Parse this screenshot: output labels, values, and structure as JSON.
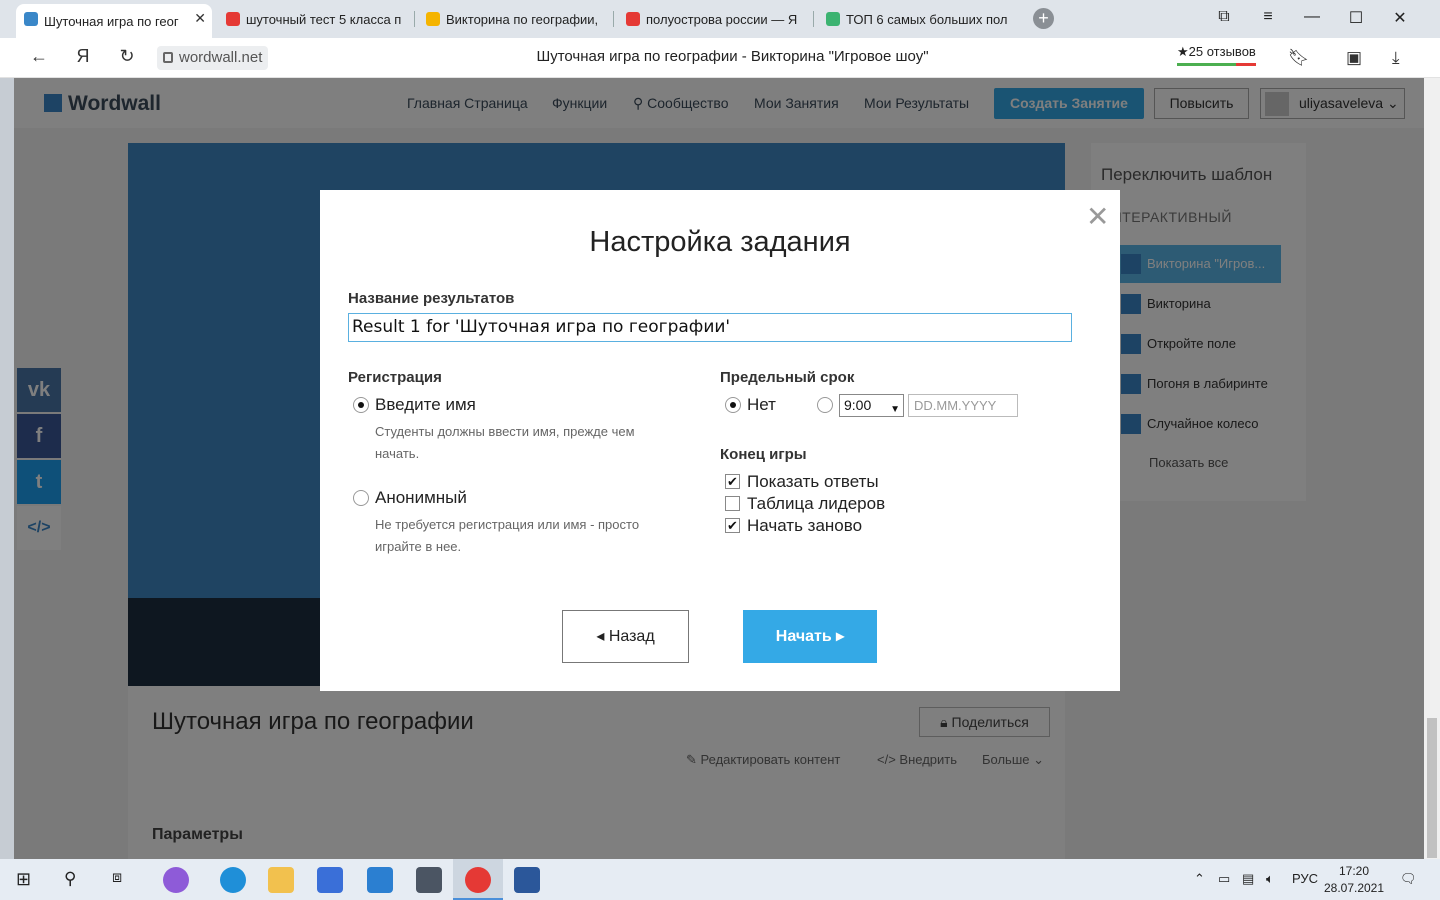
{
  "browser": {
    "tabs": [
      {
        "label": "Шуточная игра по геог",
        "active": true,
        "color": "#3a87c8"
      },
      {
        "label": "шуточный тест 5 класса п",
        "active": false,
        "color": "#e53935"
      },
      {
        "label": "Викторина по географии,",
        "active": false,
        "color": "#f5b400"
      },
      {
        "label": "полуострова россии — Я",
        "active": false,
        "color": "#e53935"
      },
      {
        "label": "ТОП 6 самых больших пол",
        "active": false,
        "color": "#3cb371"
      }
    ],
    "url": "wordwall.net",
    "page_title": "Шуточная игра по географии - Викторина \"Игровое шоу\"",
    "reviews": "★25 отзывов"
  },
  "site": {
    "logo": "Wordwall",
    "nav": [
      "Главная Страница",
      "Функции",
      "Сообщество",
      "Мои Занятия",
      "Мои Результаты"
    ],
    "create_button": "Создать Занятие",
    "upgrade_button": "Повысить",
    "username": "uliyasaveleva",
    "activity_title": "Шуточная игра по географии",
    "share_button": "Поделиться",
    "edit_link": "Редактировать контент",
    "embed_link": "Внедрить",
    "more_link": "Больше",
    "params_heading": "Параметры",
    "side": {
      "heading": "Переключить шаблон",
      "subheading": "ИНТЕРАКТИВНЫЙ",
      "items": [
        "Викторина \"Игров...",
        "Викторина",
        "Откройте поле",
        "Погоня в лабиринте",
        "Случайное колесо"
      ],
      "show_all": "Показать все"
    }
  },
  "modal": {
    "title": "Настройка задания",
    "results_label": "Название результатов",
    "results_value": "Result 1 for 'Шуточная игра по географии'",
    "registration_label": "Регистрация",
    "reg_option1": "Введите имя",
    "reg_option1_hint": "Студенты должны ввести имя, прежде чем начать.",
    "reg_option2": "Анонимный",
    "reg_option2_hint": "Не требуется регистрация или имя - просто играйте в нее.",
    "deadline_label": "Предельный срок",
    "deadline_none": "Нет",
    "deadline_time": "9:00",
    "deadline_date_placeholder": "DD.MM.YYYY",
    "end_label": "Конец игры",
    "end_options": [
      {
        "label": "Показать ответы",
        "checked": true
      },
      {
        "label": "Таблица лидеров",
        "checked": false
      },
      {
        "label": "Начать заново",
        "checked": true
      }
    ],
    "back_button": "Назад",
    "start_button": "Начать"
  },
  "taskbar": {
    "lang": "РУС",
    "time": "17:20",
    "date": "28.07.2021"
  },
  "colors": {
    "accent": "#34a9e6",
    "overlay": "rgba(0,0,0,0.5)"
  }
}
